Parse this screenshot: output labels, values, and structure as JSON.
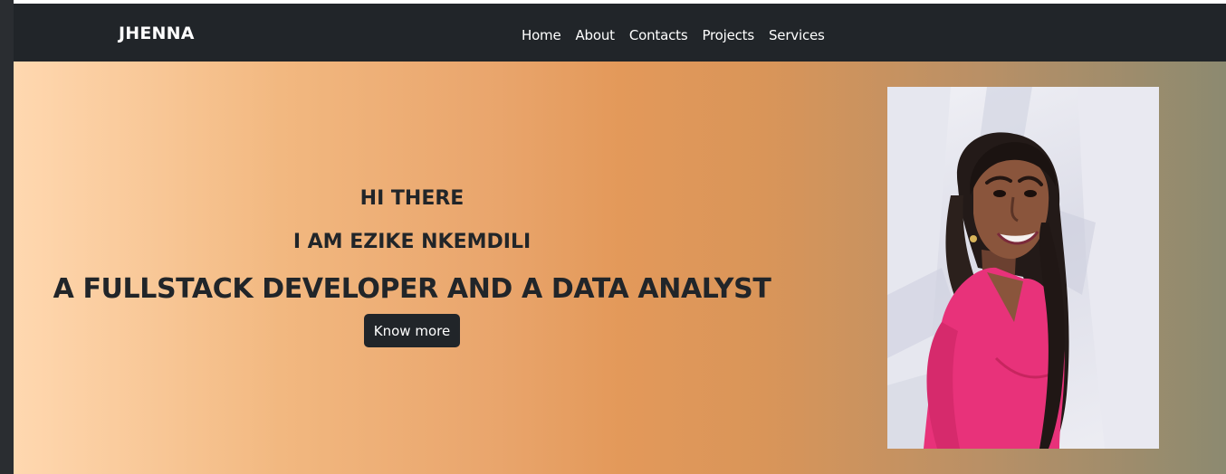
{
  "navbar": {
    "brand": "JHENNA",
    "links": [
      "Home",
      "About",
      "Contacts",
      "Projects",
      "Services"
    ]
  },
  "hero": {
    "greeting": "HI THERE",
    "name": "I AM EZIKE NKEMDILI",
    "role": "A FULLSTACK DEVELOPER AND A DATA ANALYST",
    "button_label": "Know more",
    "photo_alt": "portrait photo"
  },
  "colors": {
    "navbar_bg": "#212529",
    "button_bg": "#212529",
    "gradient_start": "#ffd8b0",
    "gradient_mid": "#e3995a",
    "gradient_end": "#8c8a70",
    "dress": "#e8327a"
  }
}
